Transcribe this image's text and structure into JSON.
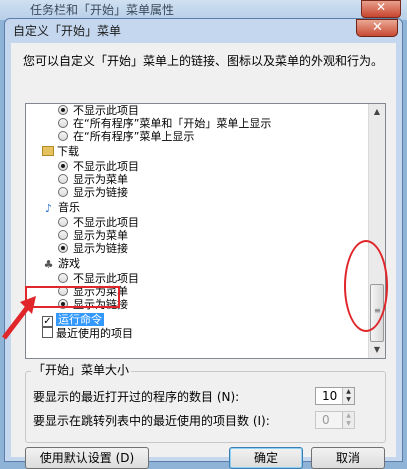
{
  "background_window": {
    "title": "任务栏和「开始」菜单属性",
    "close_glyph": "✕"
  },
  "dialog": {
    "title": "自定义「开始」菜单",
    "close_glyph": "✕"
  },
  "description": "您可以自定义「开始」菜单上的链接、图标以及菜单的外观和行为。",
  "list": {
    "items": [
      {
        "kind": "radio",
        "label": "不显示此项目",
        "checked": true
      },
      {
        "kind": "radio",
        "label": "在“所有程序”菜单和「开始」菜单上显示",
        "checked": false
      },
      {
        "kind": "radio",
        "label": "在“所有程序”菜单上显示",
        "checked": false
      },
      {
        "kind": "category",
        "label": "下载",
        "icon": "folder-icon"
      },
      {
        "kind": "radio",
        "label": "不显示此项目",
        "checked": true
      },
      {
        "kind": "radio",
        "label": "显示为菜单",
        "checked": false
      },
      {
        "kind": "radio",
        "label": "显示为链接",
        "checked": false
      },
      {
        "kind": "category",
        "label": "音乐",
        "icon": "music-note-icon"
      },
      {
        "kind": "radio",
        "label": "不显示此项目",
        "checked": false
      },
      {
        "kind": "radio",
        "label": "显示为菜单",
        "checked": false
      },
      {
        "kind": "radio",
        "label": "显示为链接",
        "checked": true
      },
      {
        "kind": "category",
        "label": "游戏",
        "icon": "game-icon"
      },
      {
        "kind": "radio",
        "label": "不显示此项目",
        "checked": false
      },
      {
        "kind": "radio",
        "label": "显示为菜单",
        "checked": false
      },
      {
        "kind": "radio",
        "label": "显示为链接",
        "checked": true
      },
      {
        "kind": "checkbox",
        "label": "运行命令",
        "checked": true,
        "selected": true
      },
      {
        "kind": "checkbox",
        "label": "最近使用的项目",
        "checked": false
      }
    ]
  },
  "start_menu_size": {
    "legend": "「开始」菜单大小",
    "recent_programs_label": "要显示的最近打开过的程序的数目 (N):",
    "recent_programs_value": "10",
    "jump_list_label": "要显示在跳转列表中的最近使用的项目数 (I):",
    "jump_list_value": "0"
  },
  "buttons": {
    "defaults": "使用默认设置 (D)",
    "ok": "确定",
    "cancel": "取消"
  },
  "annotation_color": "#e0262a"
}
